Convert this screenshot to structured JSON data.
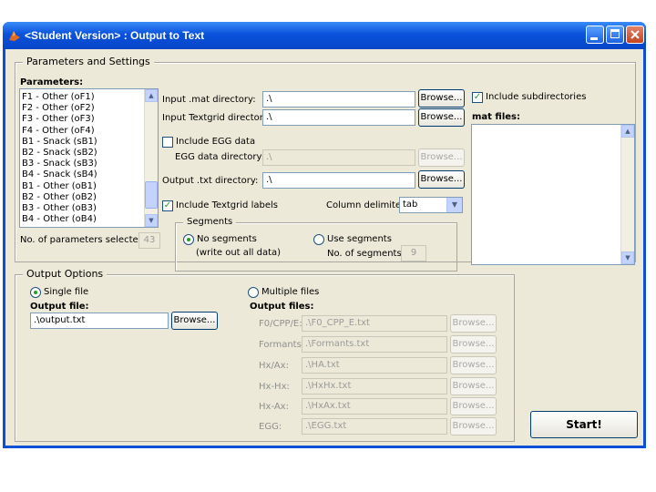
{
  "window": {
    "title": "<Student Version> : Output to Text"
  },
  "params": {
    "title": "Parameters and Settings",
    "list_label": "Parameters:",
    "items": [
      "F1 - Other (oF1)",
      "F2 - Other (oF2)",
      "F3 - Other (oF3)",
      "F4 - Other (oF4)",
      "B1 - Snack (sB1)",
      "B2 - Snack (sB2)",
      "B3 - Snack (sB3)",
      "B4 - Snack (sB4)",
      "B1 - Other (oB1)",
      "B2 - Other (oB2)",
      "B3 - Other (oB3)",
      "B4 - Other (oB4)"
    ],
    "selected_label": "No. of parameters selected:",
    "selected_value": "43",
    "mat_dir_label": "Input .mat directory:",
    "mat_dir_value": ".\\",
    "textgrid_dir_label": "Input Textgrid directory:",
    "textgrid_dir_value": ".\\",
    "include_egg_label": "Include EGG data",
    "egg_dir_label": "EGG data directory:",
    "egg_dir_value": ".\\",
    "output_dir_label": "Output .txt directory:",
    "output_dir_value": ".\\",
    "include_textgrid_label": "Include Textgrid labels",
    "delimiter_label": "Column delimiter:",
    "delimiter_value": "tab",
    "browse_label": "Browse...",
    "include_subdirs_label": "Include subdirectories",
    "mat_files_label": "mat files:",
    "segments": {
      "title": "Segments",
      "no_segments_label": "No segments",
      "no_segments_note": "(write out all data)",
      "use_segments_label": "Use segments",
      "num_segments_label": "No. of segments:",
      "num_segments_value": "9"
    }
  },
  "output": {
    "title": "Output Options",
    "single_label": "Single file",
    "output_file_label": "Output file:",
    "output_file_value": ".\\output.txt",
    "multiple_label": "Multiple files",
    "output_files_label": "Output files:",
    "files": [
      {
        "label": "F0/CPP/E:",
        "value": ".\\F0_CPP_E.txt"
      },
      {
        "label": "Formants:",
        "value": ".\\Formants.txt"
      },
      {
        "label": "Hx/Ax:",
        "value": ".\\HA.txt"
      },
      {
        "label": "Hx-Hx:",
        "value": ".\\HxHx.txt"
      },
      {
        "label": "Hx-Ax:",
        "value": ".\\HxAx.txt"
      },
      {
        "label": "EGG:",
        "value": ".\\EGG.txt"
      }
    ],
    "start_label": "Start!"
  },
  "colors": {
    "titlebar": "#0a52dc",
    "check": "#21a121",
    "face": "#ece9d8"
  }
}
